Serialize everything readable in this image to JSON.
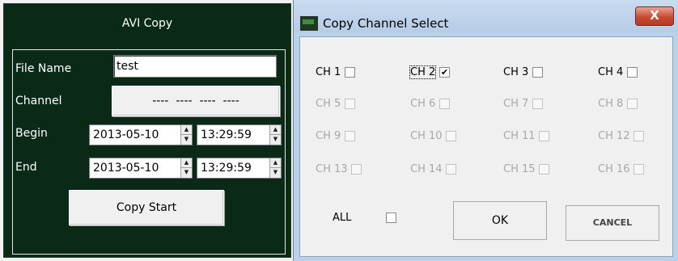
{
  "avi_copy": {
    "title": "AVI Copy",
    "file_name_label": "File Name",
    "file_name_value": "test",
    "channel_label": "Channel",
    "channel_value": "----  ----  ----  ----",
    "begin_label": "Begin",
    "begin_date": "2013-05-10",
    "begin_time": "13:29:59",
    "end_label": "End",
    "end_date": "2013-05-10",
    "end_time": "13:29:59",
    "copy_start_label": "Copy Start"
  },
  "dialog": {
    "title": "Copy Channel Select",
    "close_glyph": "X",
    "channels": [
      {
        "label": "CH 1",
        "checked": false,
        "enabled": true
      },
      {
        "label": "CH 2",
        "checked": true,
        "enabled": true
      },
      {
        "label": "CH 3",
        "checked": false,
        "enabled": true
      },
      {
        "label": "CH 4",
        "checked": false,
        "enabled": true
      },
      {
        "label": "CH 5",
        "checked": false,
        "enabled": false
      },
      {
        "label": "CH 6",
        "checked": false,
        "enabled": false
      },
      {
        "label": "CH 7",
        "checked": false,
        "enabled": false
      },
      {
        "label": "CH 8",
        "checked": false,
        "enabled": false
      },
      {
        "label": "CH 9",
        "checked": false,
        "enabled": false
      },
      {
        "label": "CH 10",
        "checked": false,
        "enabled": false
      },
      {
        "label": "CH 11",
        "checked": false,
        "enabled": false
      },
      {
        "label": "CH 12",
        "checked": false,
        "enabled": false
      },
      {
        "label": "CH 13",
        "checked": false,
        "enabled": false
      },
      {
        "label": "CH 14",
        "checked": false,
        "enabled": false
      },
      {
        "label": "CH 15",
        "checked": false,
        "enabled": false
      },
      {
        "label": "CH 16",
        "checked": false,
        "enabled": false
      }
    ],
    "all_label": "ALL",
    "all_checked": false,
    "ok_label": "OK",
    "cancel_label": "CANCEL"
  },
  "colors": {
    "panel_bg": "#0a2a17",
    "dialog_frame": "#b9d1ea",
    "close_red": "#c74a32",
    "disabled_text": "#a8a8a8"
  }
}
